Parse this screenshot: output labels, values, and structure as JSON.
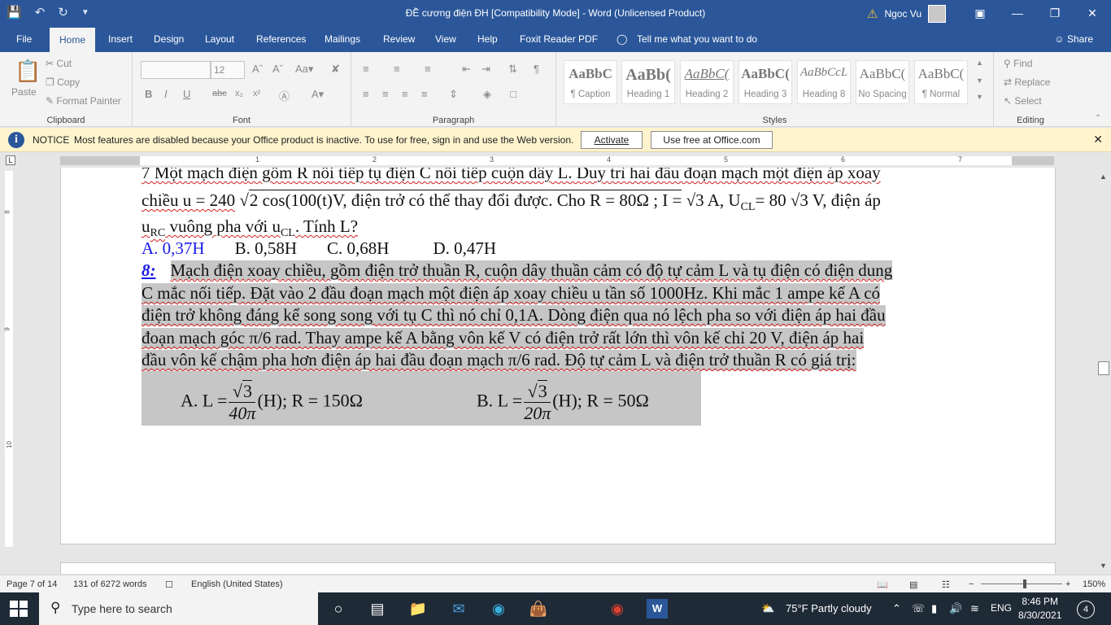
{
  "titlebar": {
    "title": "ĐỀ cương điện ĐH [Compatibility Mode]  -  Word (Unlicensed Product)",
    "user": "Ngoc Vu"
  },
  "tabs": [
    "File",
    "Home",
    "Insert",
    "Design",
    "Layout",
    "References",
    "Mailings",
    "Review",
    "View",
    "Help",
    "Foxit Reader PDF"
  ],
  "tell_me": "Tell me what you want to do",
  "share": "Share",
  "clipboard": {
    "paste": "Paste",
    "cut": "Cut",
    "copy": "Copy",
    "format_painter": "Format Painter",
    "label": "Clipboard"
  },
  "font": {
    "size": "12",
    "label": "Font"
  },
  "paragraph": {
    "label": "Paragraph"
  },
  "styles": {
    "label": "Styles",
    "items": [
      {
        "sample": "AaBbC",
        "name": "¶ Caption"
      },
      {
        "sample": "AaBb(",
        "name": "Heading 1"
      },
      {
        "sample": "AaBbC(",
        "name": "Heading 2"
      },
      {
        "sample": "AaBbC(",
        "name": "Heading 3"
      },
      {
        "sample": "AaBbCcL",
        "name": "Heading 8"
      },
      {
        "sample": "AaBbC(",
        "name": "No Spacing"
      },
      {
        "sample": "AaBbC(",
        "name": "¶ Normal"
      }
    ]
  },
  "editing": {
    "find": "Find",
    "replace": "Replace",
    "select": "Select",
    "label": "Editing"
  },
  "notice": {
    "label": "NOTICE",
    "message": "Most features are disabled because your Office product is inactive. To use for free, sign in and use the Web version.",
    "activate": "Activate",
    "use_free": "Use free at Office.com"
  },
  "ruler": {
    "numbers": [
      "1",
      "2",
      "3",
      "4",
      "5",
      "6",
      "7"
    ],
    "vnumbers": [
      "8",
      "9",
      "10"
    ]
  },
  "document": {
    "line1": "7 Một mạch điện gồm R nối tiếp tụ điện C nối tiếp cuộn dây L. Duy trì hai đầu đoạn mạch một điện áp xoay",
    "line2_a": "chiều u = 240",
    "line2_b": "2 cos(100(t)V, điện trở có thể thay đổi được. Cho R = 80Ω ; I =",
    "line2_c": "3 A, U",
    "line2_d": "CL",
    "line2_e": "= 80",
    "line2_f": "3 V, điện áp",
    "line3_a": "u",
    "line3_b": "RC",
    "line3_c": " vuông pha với u",
    "line3_d": "CL",
    "line3_e": ". Tính L?",
    "ans_a": "A. 0,37H",
    "ans_b": "B. 0,58H",
    "ans_c": "C. 0,68H",
    "ans_d": "D. 0,47H",
    "q8_num": "8:",
    "q8_l1": "Mạch điện xoay chiều, gồm điện trở thuần R, cuộn dây thuần cảm có độ tự cảm L và tụ điện có điện dung",
    "q8_l2": "C mắc nối tiếp. Đặt vào 2 đầu đoạn mạch một điện áp xoay chiều u tần số 1000Hz. Khi mắc 1 ampe kế A có",
    "q8_l3": "điện trở không đáng kể song song với tụ C thì nó chỉ 0,1A. Dòng điện qua nó lệch pha so với điện áp hai đầu",
    "q8_l4": "đoạn mạch góc   π/6 rad. Thay ampe kế A bằng vôn kế V có điện trở rất lớn thì vôn kế chỉ 20 V, điện áp hai",
    "q8_l5": "đầu vôn kế chậm pha hơn điện áp hai đầu đoạn mạch   π/6 rad. Độ tự cảm L và điện trở thuần  R có giá trị:",
    "optA_pre": "A. L =",
    "optA_num": "3",
    "optA_den": "40π",
    "optA_post": "(H); R = 150Ω",
    "optB_pre": "B. L =",
    "optB_num": "3",
    "optB_den": "20π",
    "optB_post": "(H); R = 50Ω"
  },
  "status": {
    "page": "Page 7 of 14",
    "words": "131 of 6272 words",
    "language": "English (United States)",
    "zoom": "150%"
  },
  "taskbar": {
    "search_placeholder": "Type here to search",
    "weather": "75°F  Partly cloudy",
    "lang": "ENG",
    "time": "8:46 PM",
    "date": "8/30/2021",
    "notif": "4"
  }
}
